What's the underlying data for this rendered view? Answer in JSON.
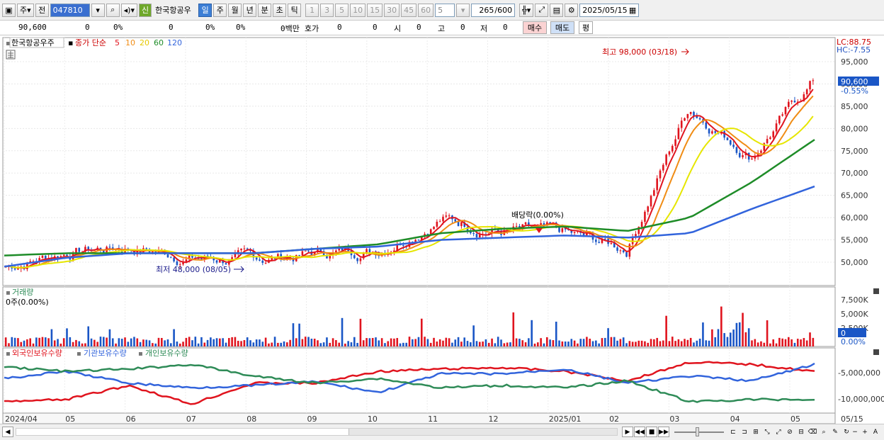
{
  "toolbar": {
    "type_label": "주",
    "prev_label": "전",
    "code_value": "047810",
    "new_badge": "신",
    "stock_name": "한국항공우",
    "periods": [
      "일",
      "주",
      "월",
      "년",
      "분",
      "초",
      "틱"
    ],
    "active_period": "일",
    "intervals": [
      "1",
      "3",
      "5",
      "10",
      "15",
      "30",
      "45",
      "60"
    ],
    "interval_input": "5",
    "count_value": "265",
    "count_total": "/600",
    "date_value": "2025/05/15"
  },
  "quote": {
    "price": "90,600",
    "change": "0",
    "change_pct": "0%",
    "volume": "0",
    "volume_pct": "0%",
    "amount": "0백만",
    "hoga_label": "호가",
    "hoga1": "0",
    "hoga2": "0",
    "open_label": "시",
    "open": "0",
    "high_label": "고",
    "high": "0",
    "low_label": "저",
    "low": "0",
    "buy_label": "매수",
    "sell_label": "매도",
    "avg_label": "평"
  },
  "price_panel": {
    "stock_tag": "한국항공우주",
    "ma_label": "종가 단순",
    "ma_periods": [
      "5",
      "10",
      "20",
      "60",
      "120"
    ],
    "ma_colors": [
      "#e0141e",
      "#f08c14",
      "#e6e600",
      "#1e8c28",
      "#3264dc"
    ],
    "lc_label": "LC:88.75",
    "hc_label": "HC:-7.55",
    "current_price": "90,600",
    "current_change": "-0.55%",
    "high_annotation": "최고 98,000 (03/18)",
    "low_annotation": "최저 48,000 (08/05)",
    "dividend_annotation": "배당락(0.00%)",
    "yticks": [
      "95,000",
      "90,000",
      "85,000",
      "80,000",
      "75,000",
      "70,000",
      "65,000",
      "60,000",
      "55,000",
      "50,000"
    ]
  },
  "volume_panel": {
    "title": "거래량",
    "value": "0주(0.00%)",
    "yticks": [
      "7,500K",
      "5,000K",
      "2,500K"
    ],
    "current": "0",
    "zero": "0.00%"
  },
  "holding_panel": {
    "series": [
      "외국인보유수량",
      "기관보유수량",
      "개인보유수량"
    ],
    "colors": [
      "#e0141e",
      "#3264dc",
      "#2e8b57"
    ],
    "yticks": [
      "-5,000,000",
      "-10,000,000"
    ]
  },
  "xaxis": [
    "2024/04",
    "05",
    "06",
    "07",
    "08",
    "09",
    "10",
    "11",
    "12",
    "2025/01",
    "02",
    "03",
    "04",
    "05"
  ],
  "xaxis_right": "05/15",
  "chart_data": {
    "type": "line",
    "title": "한국항공우주",
    "x": [
      "2024/04",
      "05",
      "06",
      "07",
      "08",
      "09",
      "10",
      "11",
      "12",
      "2025/01",
      "02",
      "03",
      "04",
      "05"
    ],
    "series": [
      {
        "name": "종가",
        "values": [
          49000,
          52500,
          53500,
          51000,
          50500,
          52000,
          53000,
          60000,
          57000,
          56000,
          53000,
          85000,
          74000,
          90600
        ]
      },
      {
        "name": "60",
        "values": [
          51500,
          52000,
          52000,
          52000,
          52000,
          53000,
          54000,
          56500,
          57500,
          58000,
          57000,
          60000,
          68000,
          77500
        ]
      },
      {
        "name": "120",
        "values": [
          49000,
          51000,
          52000,
          52000,
          52000,
          53000,
          53500,
          55000,
          55500,
          56000,
          55500,
          56500,
          62000,
          67000
        ]
      }
    ],
    "ylim": [
      48000,
      98000
    ],
    "yticks": [
      50000,
      55000,
      60000,
      65000,
      70000,
      75000,
      80000,
      85000,
      90000,
      95000
    ],
    "annotations": [
      {
        "text": "최고 98,000 (03/18)",
        "value": 98000
      },
      {
        "text": "최저 48,000 (08/05)",
        "value": 48000
      }
    ]
  }
}
